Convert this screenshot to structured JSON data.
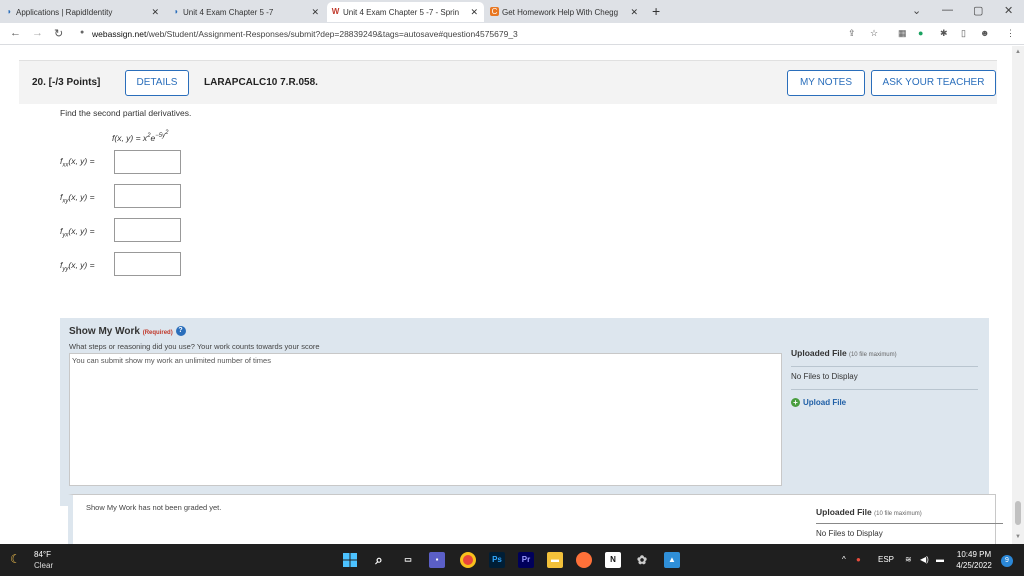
{
  "tabs": [
    {
      "title": "Applications | RapidIdentity"
    },
    {
      "title": "Unit 4 Exam Chapter 5 -7"
    },
    {
      "title": "Unit 4 Exam Chapter 5 -7 - Sprin"
    },
    {
      "title": "Get Homework Help With Chegg"
    }
  ],
  "address": {
    "host": "webassign.net",
    "path": "/web/Student/Assignment-Responses/submit?dep=28839249&tags=autosave#question4575679_3"
  },
  "question": {
    "number": "20. [-/3 Points]",
    "details_label": "DETAILS",
    "code": "LARAPCALC10 7.R.058.",
    "my_notes_label": "MY NOTES",
    "ask_teacher_label": "ASK YOUR TEACHER",
    "prompt": "Find the second partial derivatives.",
    "function_lhs": "f(x, y) = x",
    "function_exp1": "2",
    "function_e": "e",
    "function_exp2": "−5y",
    "function_exp2_sup": "2",
    "derivatives": [
      {
        "sub": "xx",
        "args": "(x, y) ="
      },
      {
        "sub": "xy",
        "args": "(x, y) ="
      },
      {
        "sub": "yx",
        "args": "(x, y) ="
      },
      {
        "sub": "yy",
        "args": "(x, y) ="
      }
    ]
  },
  "show_my_work": {
    "title": "Show My Work",
    "required": "(Required)",
    "help": "?",
    "description": "What steps or reasoning did you use? Your work counts towards your score",
    "textarea_placeholder": "You can submit show my work an unlimited number of times",
    "uploaded_file_label": "Uploaded File",
    "uploaded_file_max": "(10 file maximum)",
    "no_files": "No Files to Display",
    "upload_label": "Upload File"
  },
  "graded": {
    "text": "Show My Work has not been graded yet.",
    "uploaded_file_label": "Uploaded File",
    "uploaded_file_max": "(10 file maximum)",
    "no_files": "No Files to Display"
  },
  "taskbar": {
    "temperature": "84°F",
    "condition": "Clear",
    "language": "ESP",
    "time": "10:49 PM",
    "date": "4/25/2022",
    "notification_count": "9"
  }
}
